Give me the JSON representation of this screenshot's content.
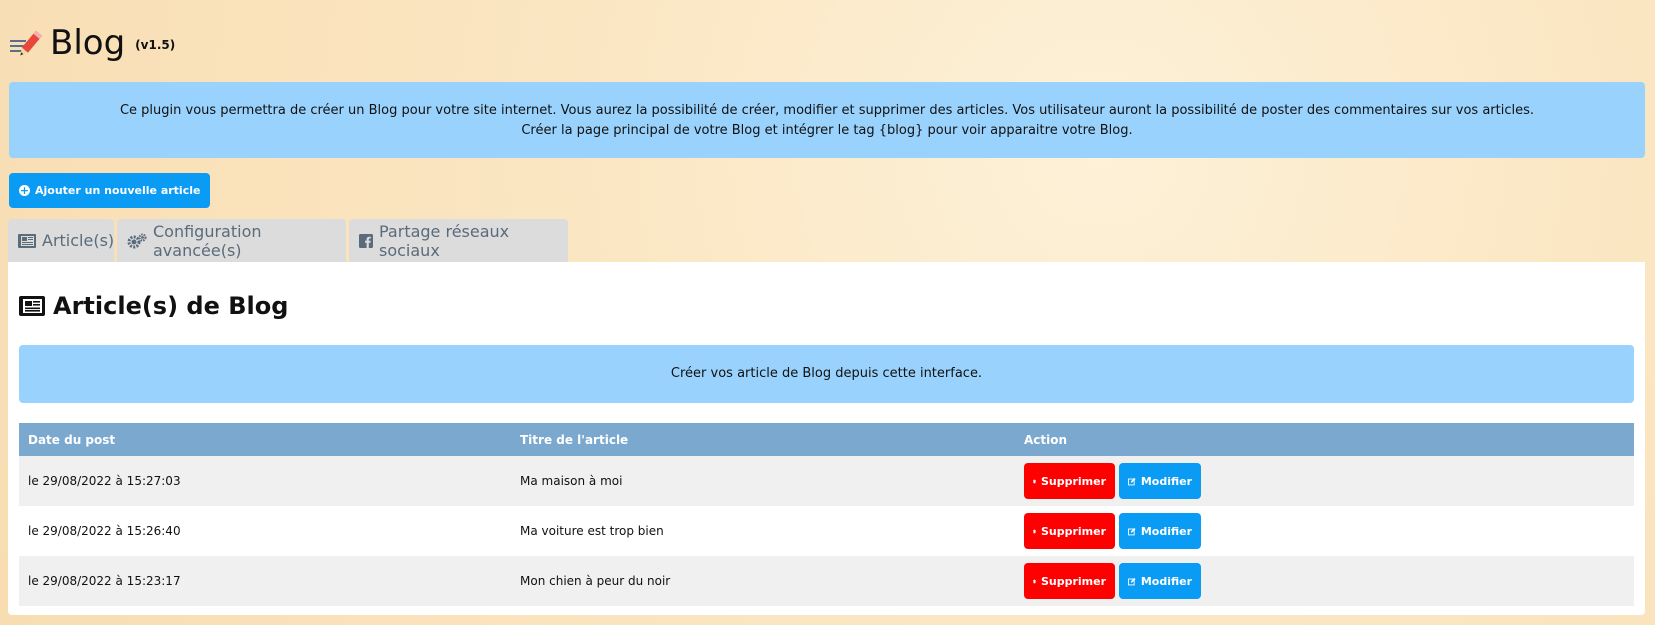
{
  "header": {
    "title": "Blog",
    "version": "(v1.5)"
  },
  "info": {
    "line1": "Ce plugin vous permettra de créer un Blog pour votre site internet. Vous aurez la possibilité de créer, modifier et supprimer des articles. Vos utilisateur auront la possibilité de poster des commentaires sur vos articles.",
    "line2": "Créer la page principal de votre Blog et intégrer le tag {blog} pour voir apparaitre votre Blog."
  },
  "add_button": {
    "label": "Ajouter un nouvelle article",
    "icon": "plus-circle-icon"
  },
  "tabs": [
    {
      "label": "Article(s)",
      "icon": "newspaper-icon"
    },
    {
      "label": "Configuration avancée(s)",
      "icon": "cogs-icon"
    },
    {
      "label": "Partage réseaux sociaux",
      "icon": "facebook-icon"
    }
  ],
  "panel": {
    "title": "Article(s) de Blog",
    "info": "Créer vos article de Blog depuis cette interface."
  },
  "table": {
    "headers": [
      "Date du post",
      "Titre de l'article",
      "Action"
    ],
    "rows": [
      {
        "date": "le 29/08/2022 à 15:27:03",
        "title": "Ma maison à moi"
      },
      {
        "date": "le 29/08/2022 à 15:26:40",
        "title": "Ma voiture est trop bien"
      },
      {
        "date": "le 29/08/2022 à 15:23:17",
        "title": "Mon chien à peur du noir"
      }
    ],
    "delete_label": "Supprimer",
    "edit_label": "Modifier"
  },
  "colors": {
    "info_bg": "#99d3fd",
    "primary": "#0a9bf5",
    "danger": "#ff0000",
    "table_header": "#7aa8cf"
  }
}
